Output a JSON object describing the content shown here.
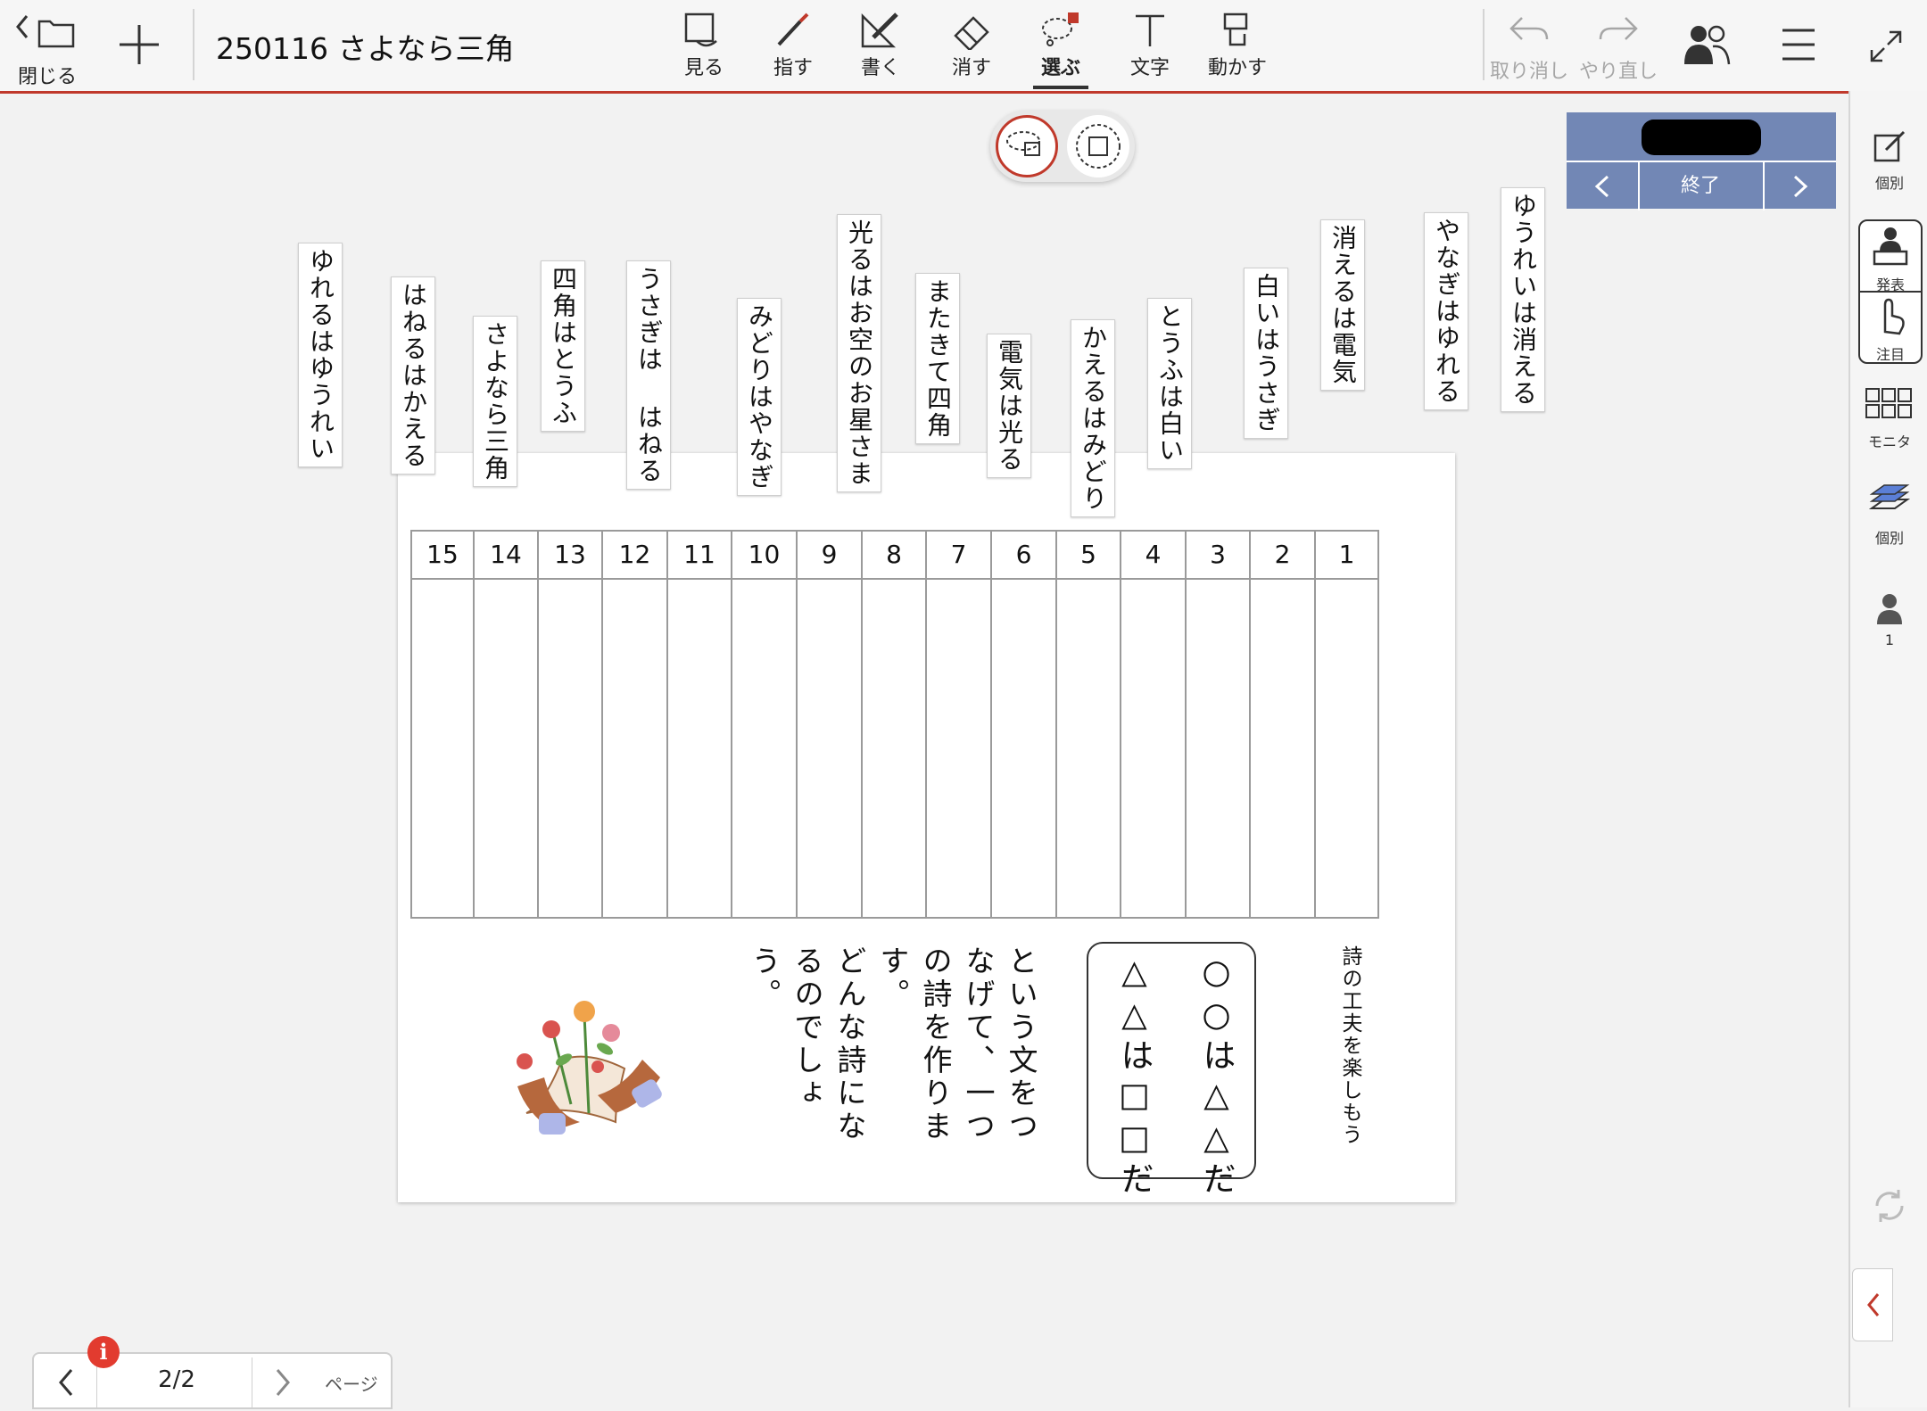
{
  "toolbar": {
    "close_label": "閉じる",
    "doc_title": "250116 さよなら三角",
    "tools": [
      "見る",
      "指す",
      "書く",
      "消す",
      "選ぶ",
      "文字",
      "動かす"
    ],
    "active_tool": "選ぶ",
    "undo_label": "取り消し",
    "redo_label": "やり直し"
  },
  "session": {
    "name": "████",
    "end_label": "終了"
  },
  "sidebar": {
    "individual_label": "個別",
    "present_label": "発表",
    "attention_label": "注目",
    "monitor_label": "モニタ",
    "layer_label": "個別",
    "user_count": "1"
  },
  "cards": [
    "ゆれるはゆうれい",
    "はねるはかえる",
    "さよなら三角",
    "四角はとうふ",
    "うさぎは はねる",
    "みどりはやなぎ",
    "光るはお空のお星さま",
    "またきて四角",
    "電気は光る",
    "かえるはみどり",
    "とうふは白い",
    "白いはうさぎ",
    "消えるは電気",
    "やなぎはゆれる",
    "ゆうれいは消える"
  ],
  "worksheet": {
    "column_numbers": [
      "15",
      "14",
      "13",
      "12",
      "11",
      "10",
      "9",
      "8",
      "7",
      "6",
      "5",
      "4",
      "3",
      "2",
      "1"
    ],
    "hint": "詩の工夫を楽しもう",
    "pattern_line1": "○○は△△だ",
    "pattern_line2": "△△は□□だ",
    "instruction_lines": [
      "という文をつ",
      "なげて、一つ",
      "の詩を作りま",
      "す。",
      "どんな詩にな",
      "るのでしょ",
      "う。"
    ]
  },
  "pager": {
    "page_count": "2/2",
    "page_label": "ページ",
    "info_badge": "i"
  },
  "colors": {
    "accent": "#c0392b",
    "session_panel": "#7287b5",
    "info_badge": "#e23b2f"
  }
}
